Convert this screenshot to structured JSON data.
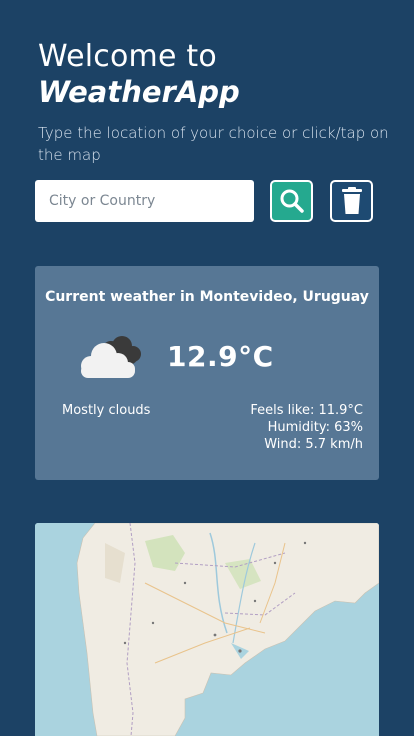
{
  "header": {
    "welcome_text": "Welcome to",
    "app_name": "WeatherApp",
    "instructions": "Type the location of your choice or click/tap on the map"
  },
  "search": {
    "placeholder": "City or Country",
    "value": "",
    "search_icon": "search-icon",
    "clear_icon": "trash-icon"
  },
  "weather": {
    "title": "Current weather in Montevideo, Uruguay",
    "icon": "cloud-icon",
    "temperature": "12.9°C",
    "condition": "Mostly clouds",
    "feels_like": "Feels like: 11.9°C",
    "humidity": "Humidity: 63%",
    "wind": "Wind: 5.7 km/h"
  },
  "colors": {
    "background": "#1c4265",
    "card": "#577795",
    "search_button": "#25a98f",
    "clear_button": "#1e4a72",
    "sea": "#aad3df",
    "land": "#f0ece3"
  }
}
